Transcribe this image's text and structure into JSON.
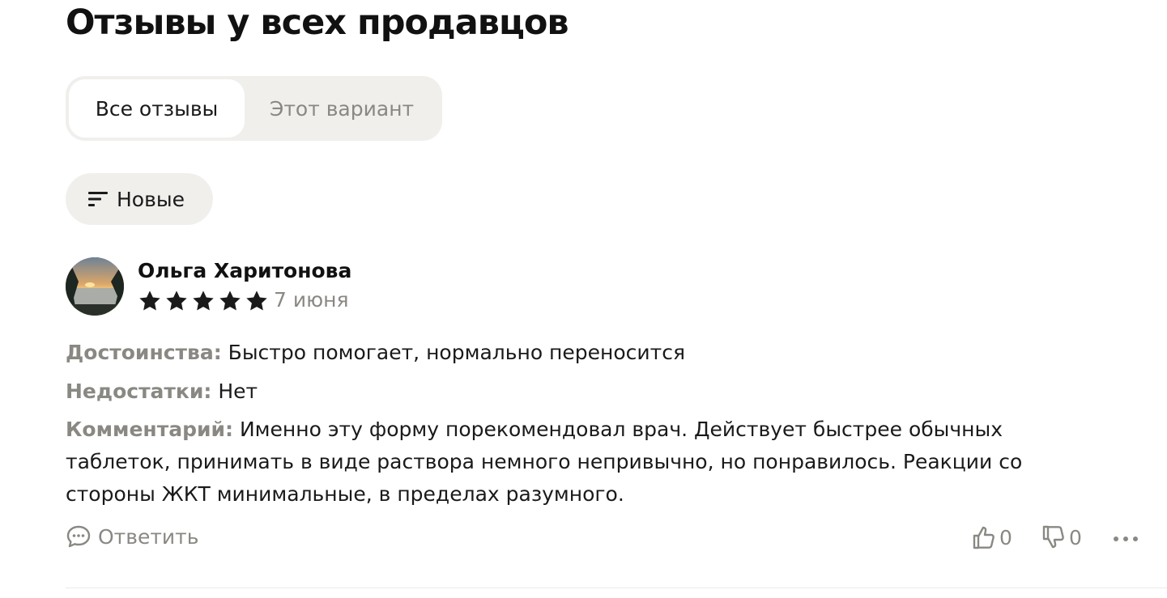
{
  "page_title": "Отзывы у всех продавцов",
  "tabs": [
    {
      "label": "Все отзывы",
      "active": true
    },
    {
      "label": "Этот вариант",
      "active": false
    }
  ],
  "sort": {
    "label": "Новые",
    "icon": "sort-lines-icon"
  },
  "review": {
    "author": "Ольга Харитонова",
    "rating": 5,
    "rating_max": 5,
    "date": "7 июня",
    "pros_label": "Достоинства:",
    "pros": "Быстро помогает, нормально переносится",
    "cons_label": "Недостатки:",
    "cons": "Нет",
    "comment_label": "Комментарий:",
    "comment": "Именно эту форму порекомендовал врач. Действует быстрее обычных таблеток, принимать в виде раствора немного непривычно, но понравилось. Реакции со стороны ЖКТ минимальные, в пределах разумного.",
    "reply_label": "Ответить",
    "likes": "0",
    "dislikes": "0"
  },
  "colors": {
    "text": "#1a1a1a",
    "muted": "#8a8883",
    "chip_bg": "#f0efec",
    "divider": "#ebeae7"
  }
}
